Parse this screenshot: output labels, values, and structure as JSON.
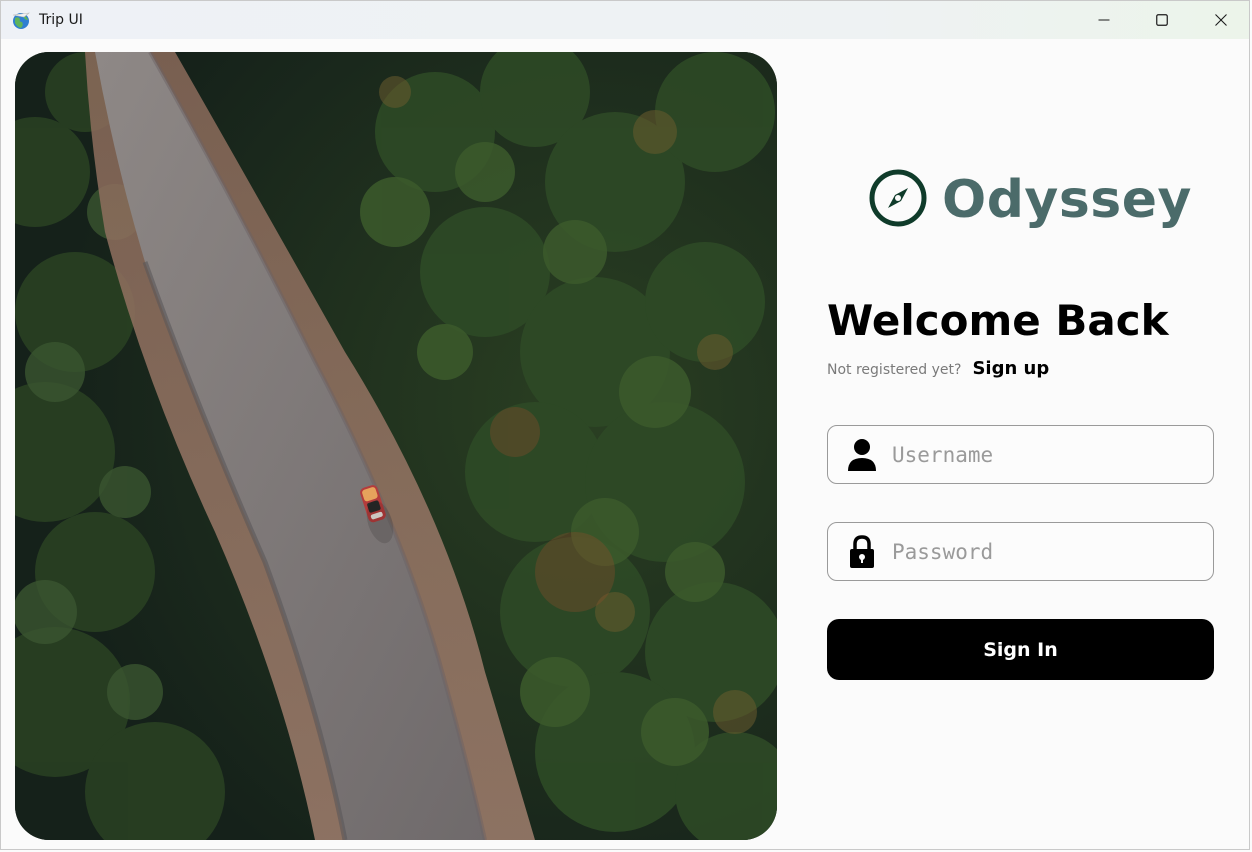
{
  "window": {
    "title": "Trip UI",
    "app_icon": "globe-airplane-icon",
    "controls": [
      "minimize-icon",
      "maximize-icon",
      "close-icon"
    ]
  },
  "hero": {
    "icon": "aerial-forest-road-photo"
  },
  "brand": {
    "name": "Odyssey",
    "logo_icon": "compass-icon",
    "color": "#4b6b6a",
    "logo_color": "#0f3b2a"
  },
  "login": {
    "heading": "Welcome Back",
    "not_registered": "Not registered yet?",
    "signup_label": "Sign up",
    "username": {
      "placeholder": "Username",
      "value": "",
      "icon": "user-icon"
    },
    "password": {
      "placeholder": "Password",
      "value": "",
      "icon": "lock-icon"
    },
    "signin_label": "Sign In"
  }
}
